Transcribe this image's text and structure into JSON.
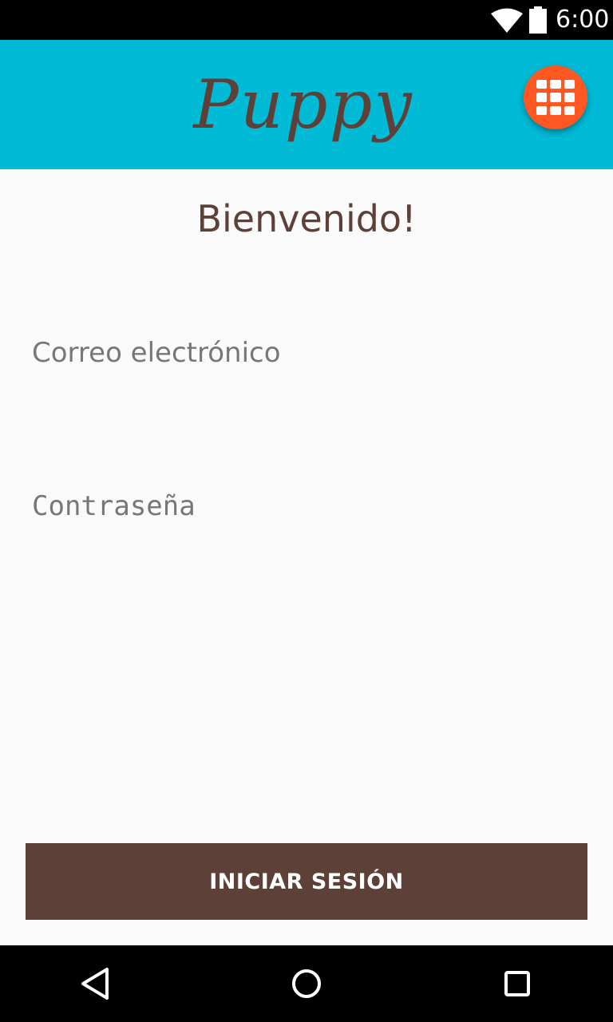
{
  "status_bar": {
    "time": "6:00",
    "icons": [
      "wifi-icon",
      "battery-icon"
    ]
  },
  "app_bar": {
    "title": "Puppy",
    "menu_icon": "grid-menu-icon",
    "background_color": "#00bad6",
    "fab_color": "#ff5722"
  },
  "content": {
    "welcome": "Bienvenido!",
    "email_placeholder": "Correo electrónico",
    "email_value": "",
    "password_placeholder": "Contraseña",
    "password_value": "",
    "login_button": "INICIAR SESIÓN"
  },
  "nav_bar": {
    "icons": [
      "back-icon",
      "home-icon",
      "recents-icon"
    ]
  },
  "colors": {
    "brand_brown": "#5d4037",
    "page_background": "#fafafa"
  }
}
